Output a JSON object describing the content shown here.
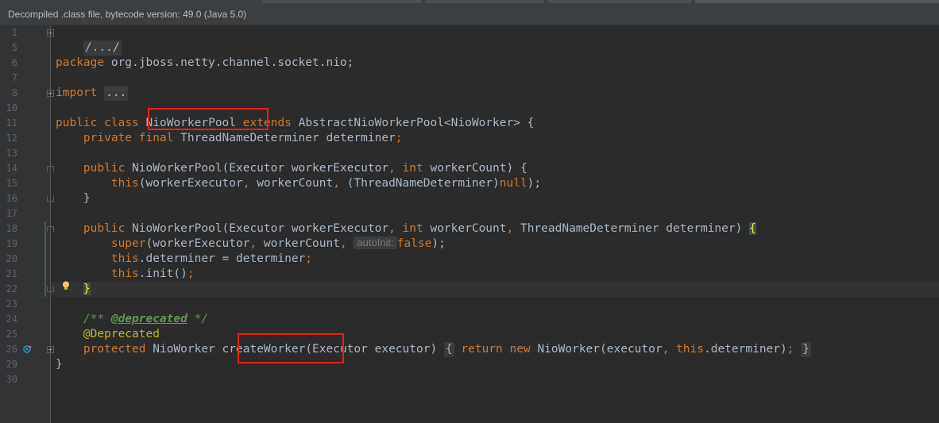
{
  "banner": {
    "text": "Decompiled .class file, bytecode version: 49.0 (Java 5.0)"
  },
  "lines": [
    {
      "num": "1",
      "code": "/.../"
    },
    {
      "num": "5",
      "code": ""
    },
    {
      "num": "6",
      "code": "package org.jboss.netty.channel.socket.nio;"
    },
    {
      "num": "7",
      "code": ""
    },
    {
      "num": "8",
      "code": "import ..."
    },
    {
      "num": "10",
      "code": ""
    },
    {
      "num": "11",
      "code": "public class NioWorkerPool extends AbstractNioWorkerPool<NioWorker> {"
    },
    {
      "num": "12",
      "code": "    private final ThreadNameDeterminer determiner;"
    },
    {
      "num": "13",
      "code": ""
    },
    {
      "num": "14",
      "code": "    public NioWorkerPool(Executor workerExecutor, int workerCount) {"
    },
    {
      "num": "15",
      "code": "        this(workerExecutor, workerCount, (ThreadNameDeterminer)null);"
    },
    {
      "num": "16",
      "code": "    }"
    },
    {
      "num": "17",
      "code": ""
    },
    {
      "num": "18",
      "code": "    public NioWorkerPool(Executor workerExecutor, int workerCount, ThreadNameDeterminer determiner) {"
    },
    {
      "num": "19",
      "code": "        super(workerExecutor, workerCount, autoInit: false);"
    },
    {
      "num": "20",
      "code": "        this.determiner = determiner;"
    },
    {
      "num": "21",
      "code": "        this.init();"
    },
    {
      "num": "22",
      "code": "    }"
    },
    {
      "num": "23",
      "code": ""
    },
    {
      "num": "24",
      "code": "    /** @deprecated */"
    },
    {
      "num": "25",
      "code": "    @Deprecated"
    },
    {
      "num": "26",
      "code": "    protected NioWorker createWorker(Executor executor) { return new NioWorker(executor, this.determiner); }"
    },
    {
      "num": "29",
      "code": "}"
    },
    {
      "num": "30",
      "code": ""
    }
  ],
  "tokens": {
    "l1_fold": "/.../",
    "l6_kw": "package",
    "l6_pkg": "org.jboss.netty.channel.socket.nio;",
    "l8_kw": "import",
    "l8_fold": "...",
    "l11_kw1": "public",
    "l11_kw2": "class",
    "l11_name": "NioWorkerPool",
    "l11_kw3": "extends",
    "l11_rest": "AbstractNioWorkerPool<NioWorker> {",
    "l12_kw1": "private",
    "l12_kw2": "final",
    "l12_rest": "ThreadNameDeterminer determiner",
    "l12_semi": ";",
    "l14_kw": "public",
    "l14_a": "NioWorkerPool(Executor workerExecutor",
    "l14_comma": ",",
    "l14_int": "int",
    "l14_b": "workerCount) {",
    "l15_this": "this",
    "l15_a": "(workerExecutor",
    "l15_c1": ",",
    "l15_b": "workerCount",
    "l15_c2": ",",
    "l15_c": "(ThreadNameDeterminer)",
    "l15_null": "null",
    "l15_end": ");",
    "l16": "}",
    "l18_kw": "public",
    "l18_a": "NioWorkerPool(Executor workerExecutor",
    "l18_c1": ",",
    "l18_int": "int",
    "l18_b": "workerCount",
    "l18_c2": ",",
    "l18_c": "ThreadNameDeterminer determiner)",
    "l18_brace": "{",
    "l19_super": "super",
    "l19_a": "(workerExecutor",
    "l19_c1": ",",
    "l19_b": "workerCount",
    "l19_c2": ",",
    "l19_hint": "autoInit:",
    "l19_false": "false",
    "l19_end": ");",
    "l20_this": "this",
    "l20_a": ".determiner = determiner",
    "l20_semi": ";",
    "l21_this": "this",
    "l21_a": ".init()",
    "l21_semi": ";",
    "l22_brace": "}",
    "l24_a": "/** ",
    "l24_tag": "@deprecated",
    "l24_b": " */",
    "l25_ann": "@Deprecated",
    "l26_kw": "protected",
    "l26_type": "NioWorker",
    "l26_name": "createWorker",
    "l26_a": "(Executor executor)",
    "l26_ob": "{",
    "l26_ret": "return",
    "l26_new": "new",
    "l26_b": "NioWorker(executor",
    "l26_c": ",",
    "l26_this": "this",
    "l26_d": ".determiner)",
    "l26_semi": ";",
    "l26_cb": "}",
    "l29": "}"
  },
  "colors": {
    "keyword": "#cc7832",
    "method": "#ffc66d",
    "comment": "#629755",
    "annotation": "#bbb529",
    "text": "#a9b7c6",
    "highlight_box": "#e2221a"
  }
}
